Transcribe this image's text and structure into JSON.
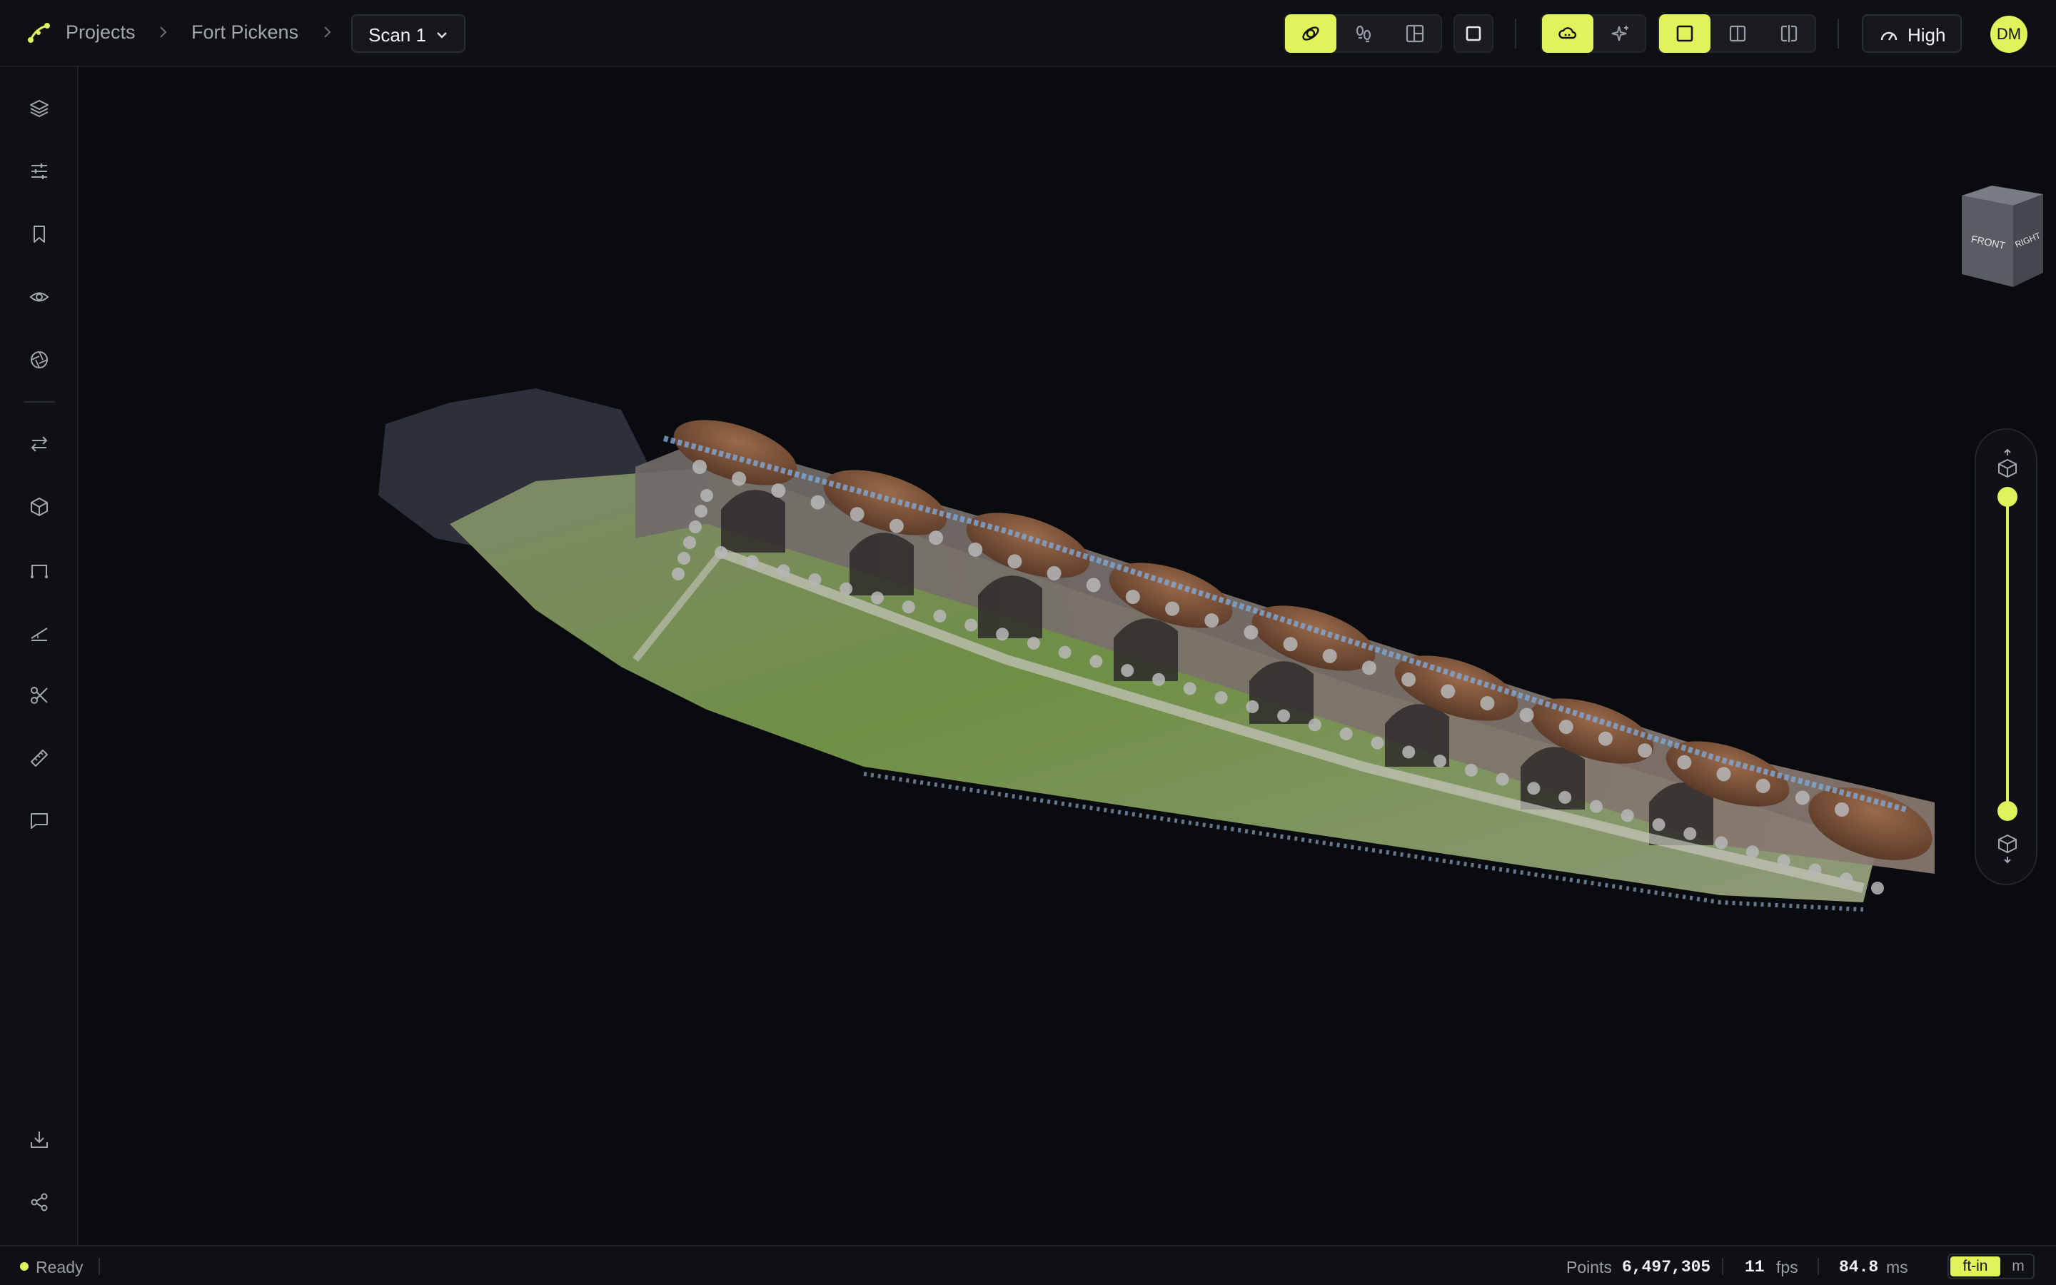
{
  "header": {
    "breadcrumb": [
      "Projects",
      "Fort Pickens"
    ],
    "scan_select": "Scan 1",
    "quality_label": "High",
    "avatar_initials": "DM"
  },
  "toolbar": {
    "icons": [
      "orbit-icon",
      "walk-icon",
      "layout-icon",
      "square-icon",
      "cloud-icon",
      "sparkle-icon",
      "single-view-icon",
      "split-view-icon",
      "compare-view-icon",
      "gauge-icon"
    ],
    "active": [
      "orbit",
      "cloud",
      "single-view"
    ]
  },
  "sidebar": {
    "icons": [
      "layers-icon",
      "sliders-icon",
      "bookmark-icon",
      "eye-icon",
      "aperture-icon",
      "swap-icon",
      "cube-icon",
      "path-icon",
      "slope-icon",
      "scissors-icon",
      "ruler-icon",
      "comment-icon",
      "download-icon",
      "share-icon"
    ]
  },
  "navcube": {
    "front": "FRONT",
    "right": "RIGHT"
  },
  "status": {
    "state": "Ready",
    "points_label": "Points",
    "points_value": "6,497,305",
    "fps_value": "11",
    "fps_label": "fps",
    "ms_value": "84.8",
    "ms_label": "ms",
    "unit_active": "ft-in",
    "unit_other": "m"
  },
  "colors": {
    "accent": "#dff35a",
    "background": "#0a0b0f",
    "panel": "#0f1014"
  }
}
